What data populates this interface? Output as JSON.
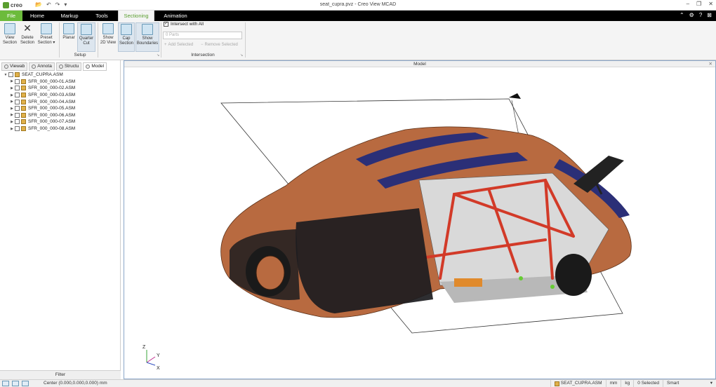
{
  "titlebar": {
    "logo": "creo",
    "window_title": "seat_cupra.pvz - Creo View MCAD",
    "qat_icons": [
      "open-icon",
      "undo-icon",
      "redo-icon",
      "customize-icon"
    ],
    "window_icons": [
      "minimize-icon",
      "restore-icon",
      "close-icon"
    ]
  },
  "tabs": {
    "file": "File",
    "home": "Home",
    "markup": "Markup",
    "tools": "Tools",
    "sectioning": "Sectioning",
    "animation": "Animation",
    "active": "Sectioning"
  },
  "ribbon": {
    "setup": {
      "label": "Setup",
      "view_section": [
        "View",
        "Section"
      ],
      "delete_section": [
        "Delete",
        "Section"
      ],
      "preset_section": [
        "Preset",
        "Section ▾"
      ],
      "planar": [
        "Planar"
      ],
      "quarter_cut": [
        "Quarter",
        "Cut"
      ],
      "show_2d_view": [
        "Show",
        "2D View"
      ],
      "cap_section": [
        "Cap",
        "Section"
      ],
      "show_boundaries": [
        "Show",
        "Boundaries"
      ]
    },
    "intersection": {
      "label": "Intersection",
      "intersect_with_all": "Intersect with All",
      "intersect_checked": true,
      "parts_placeholder": "0 Parts",
      "add_selected": "Add Selected",
      "remove_selected": "Remove Selected"
    }
  },
  "left_panel": {
    "tabs": [
      "Viewab",
      "Annota",
      "Structu",
      "Model"
    ],
    "active_tab": "Model",
    "tree": {
      "root": "SEAT_CUPRA.ASM",
      "children": [
        "SFR_000_000-01.ASM",
        "SFR_000_000-02.ASM",
        "SFR_000_000-03.ASM",
        "SFR_000_000-04.ASM",
        "SFR_000_000-05.ASM",
        "SFR_000_000-06.ASM",
        "SFR_000_000-07.ASM",
        "SFR_000_000-08.ASM"
      ]
    },
    "filter_label": "Filter"
  },
  "viewport": {
    "title": "Model",
    "axis_labels": {
      "z": "Z",
      "y": "Y",
      "x": "X"
    },
    "colors": {
      "body_copper": "#b86a40",
      "stripe_navy": "#2b2f77",
      "cage_red": "#d23a28",
      "floor_grey": "#b8b8b8",
      "dark": "#1c1c20"
    }
  },
  "statusbar": {
    "center": "Center (0.000,0.000,0.000) mm",
    "model": "SEAT_CUPRA.ASM",
    "length_unit": "mm",
    "mass_unit": "kg",
    "selected": "0 Selected",
    "filter_mode": "Smart"
  }
}
